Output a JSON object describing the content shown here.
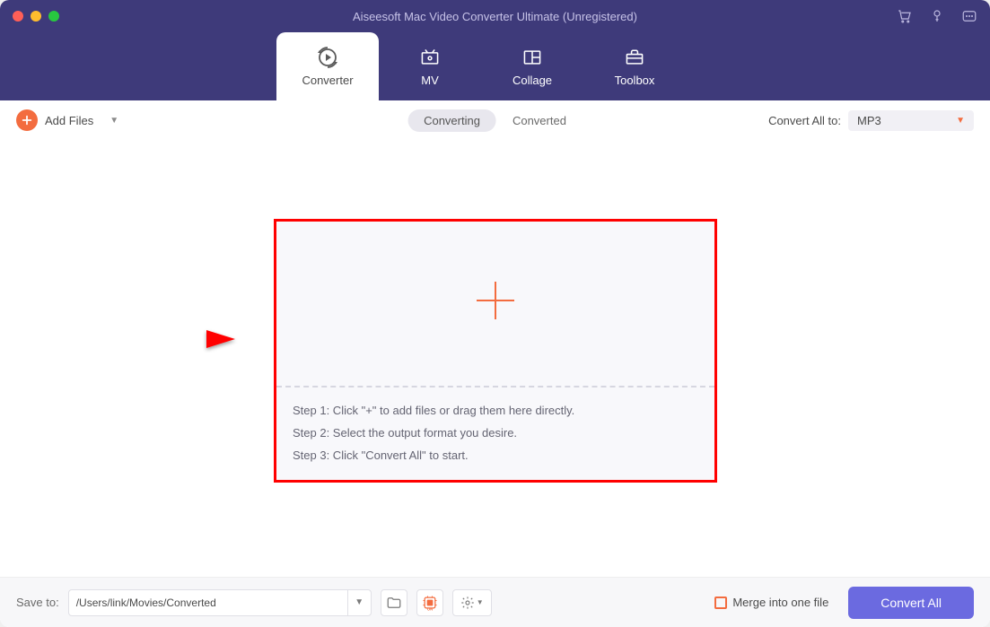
{
  "window": {
    "title": "Aiseesoft Mac Video Converter Ultimate (Unregistered)"
  },
  "nav": {
    "converter": "Converter",
    "mv": "MV",
    "collage": "Collage",
    "toolbox": "Toolbox"
  },
  "subbar": {
    "add_files": "Add Files",
    "tab_converting": "Converting",
    "tab_converted": "Converted",
    "convert_all_to": "Convert All to:",
    "format": "MP3"
  },
  "dropzone": {
    "step1": "Step 1: Click \"+\" to add files or drag them here directly.",
    "step2": "Step 2: Select the output format you desire.",
    "step3": "Step 3: Click \"Convert All\" to start."
  },
  "bottom": {
    "save_to": "Save to:",
    "path": "/Users/link/Movies/Converted",
    "merge": "Merge into one file",
    "convert_all": "Convert All"
  }
}
